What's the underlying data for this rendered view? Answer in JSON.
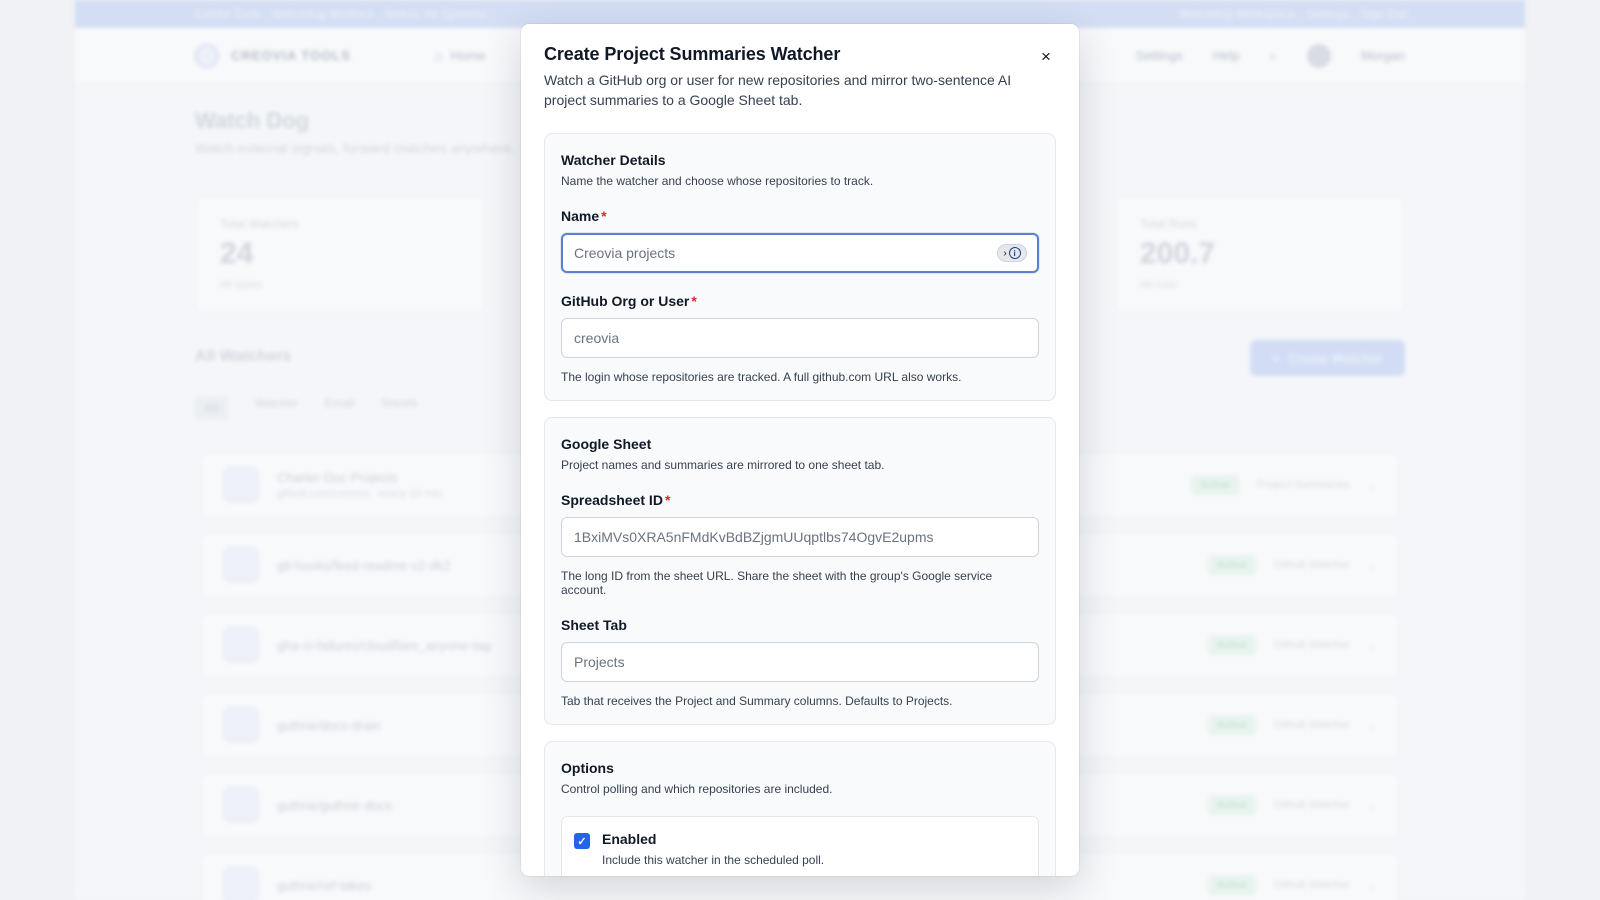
{
  "background": {
    "banner_left": "Cardel Tools · Watchdog Workers · Status: All Systems",
    "banner_right": "Watchdog Workspace · Settings · Sign Out",
    "logo_text": "CREOVIA TOOLS",
    "nav": [
      {
        "label": "Home"
      }
    ],
    "nav_right": [
      {
        "label": "Settings"
      },
      {
        "label": "Help"
      },
      {
        "label": "Morgan"
      }
    ],
    "page_title": "Watch Dog",
    "page_subtitle": "Watch external signals, forward matches anywhere.",
    "stats": [
      {
        "label": "Total Watchers",
        "value": "24",
        "hint": "All types"
      },
      {
        "label": "Total Runs",
        "value": "200.7",
        "hint": "All runs"
      }
    ],
    "section_title": "All Watchers",
    "create_label": "Create Watcher",
    "filters": [
      "All",
      "Watcher",
      "Email",
      "Sheets"
    ],
    "rows": [
      {
        "name": "Charter Doc Projects",
        "sub": "github.com/creovia · every 15 min",
        "status": "Active",
        "type": "Project Summaries"
      },
      {
        "name": "git-hooks/feed-readme-v2-dk2",
        "sub": "",
        "status": "Active",
        "type": "Github Watcher"
      },
      {
        "name": "gha-ci-failures/cloudflare_anyone-tag",
        "sub": "",
        "status": "Active",
        "type": "Github Watcher"
      },
      {
        "name": "guthrie/docs-drain",
        "sub": "",
        "status": "Active",
        "type": "Github Watcher"
      },
      {
        "name": "guthrie/guthrie-docs",
        "sub": "",
        "status": "Active",
        "type": "Github Watcher"
      },
      {
        "name": "guthrie/ref-takes",
        "sub": "",
        "status": "Active",
        "type": "Github Watcher"
      }
    ]
  },
  "modal": {
    "title": "Create Project Summaries Watcher",
    "description": "Watch a GitHub org or user for new repositories and mirror two-sentence AI project summaries to a Google Sheet tab.",
    "close_icon": "×",
    "sections": {
      "details": {
        "title": "Watcher Details",
        "description": "Name the watcher and choose whose repositories to track.",
        "name_label": "Name",
        "name_placeholder": "Creovia projects",
        "org_label": "GitHub Org or User",
        "org_placeholder": "creovia",
        "org_help": "The login whose repositories are tracked. A full github.com URL also works."
      },
      "sheet": {
        "title": "Google Sheet",
        "description": "Project names and summaries are mirrored to one sheet tab.",
        "spreadsheet_label": "Spreadsheet ID",
        "spreadsheet_placeholder": "1BxiMVs0XRA5nFMdKvBdBZjgmUUqptlbs74OgvE2upms",
        "spreadsheet_help": "The long ID from the sheet URL. Share the sheet with the group's Google service account.",
        "tab_label": "Sheet Tab",
        "tab_placeholder": "Projects",
        "tab_help": "Tab that receives the Project and Summary columns. Defaults to Projects."
      },
      "options": {
        "title": "Options",
        "description": "Control polling and which repositories are included.",
        "enabled_title": "Enabled",
        "enabled_desc": "Include this watcher in the scheduled poll.",
        "enabled_checked": true
      }
    },
    "required_mark": "*"
  },
  "colors": {
    "accent": "#2563eb",
    "focus_ring": "#5b7fd1",
    "required": "#dc2626"
  }
}
